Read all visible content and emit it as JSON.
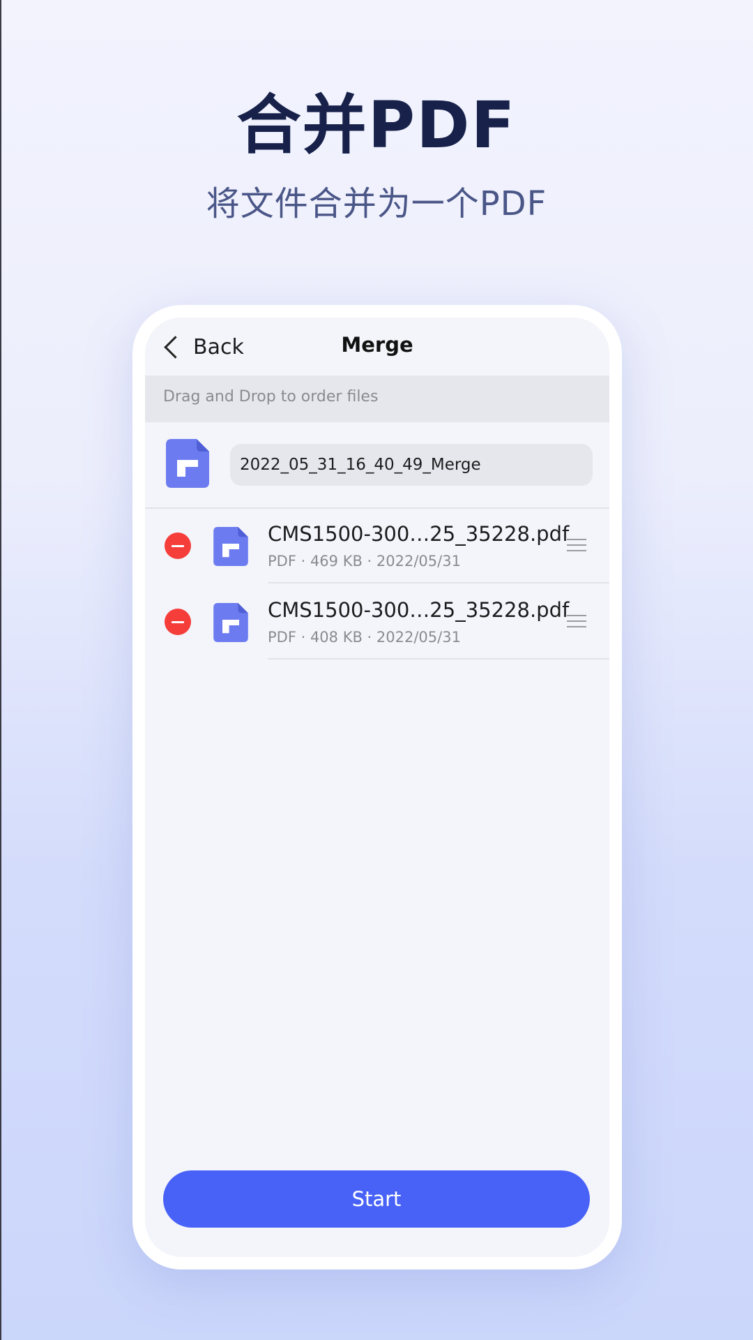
{
  "hero": {
    "title": "合并PDF",
    "subtitle": "将文件合并为一个PDF"
  },
  "nav": {
    "back_label": "Back",
    "title": "Merge"
  },
  "hint": "Drag and Drop to order files",
  "output_name": {
    "value": "2022_05_31_16_40_49_Merge"
  },
  "files": [
    {
      "name": "CMS1500-300…25_35228.pdf",
      "meta": "PDF · 469 KB · 2022/05/31"
    },
    {
      "name": "CMS1500-300…25_35228.pdf",
      "meta": "PDF · 408 KB · 2022/05/31"
    }
  ],
  "start_label": "Start",
  "colors": {
    "accent": "#4862f8",
    "remove": "#f53d3a",
    "doc_icon": "#6c7cf0",
    "title": "#17214a"
  },
  "icons": {
    "back": "chevron-left-icon",
    "file": "pdf-file-icon",
    "remove": "minus-circle-icon",
    "drag": "drag-handle-icon"
  }
}
